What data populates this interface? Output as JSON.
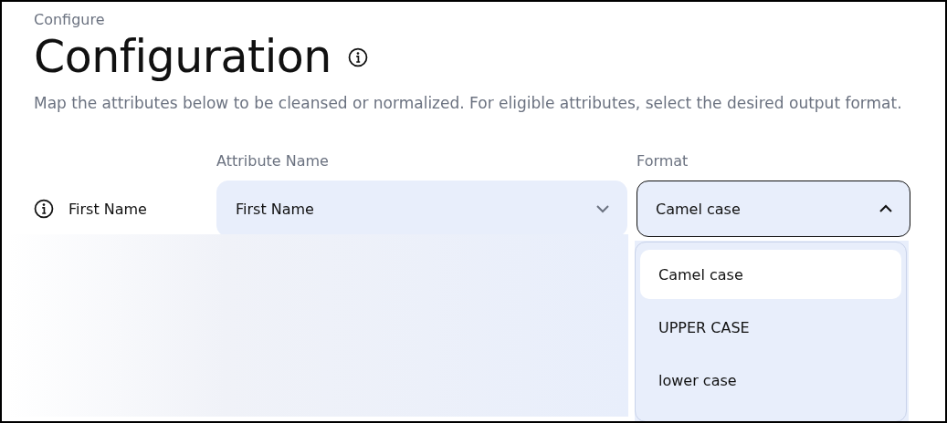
{
  "breadcrumb": "Configure",
  "title": "Configuration",
  "description": "Map the attributes below to be cleansed or normalized. For eligible attributes, select the desired output format.",
  "columns": [
    "Attribute Name",
    "Format"
  ],
  "rows": [
    {
      "label": "First Name",
      "attribute": {
        "value": "First Name",
        "expanded": false
      },
      "format": {
        "value": "Camel case",
        "expanded": true,
        "options": [
          {
            "label": "Camel case",
            "selected": true
          },
          {
            "label": "UPPER CASE",
            "selected": false
          },
          {
            "label": "lower case",
            "selected": false
          }
        ]
      }
    }
  ]
}
